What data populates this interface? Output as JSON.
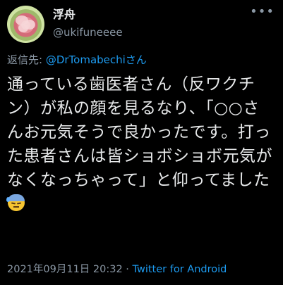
{
  "user": {
    "display_name": "浮舟",
    "handle": "@ukifuneeee"
  },
  "reply": {
    "prefix": "返信先: ",
    "mention": "@DrTomabechiさん"
  },
  "tweet": {
    "text": "通っている歯医者さん（反ワクチン）が私の顔を見るなり、「○○さんお元気そうで良かったです。打った患者さんは皆ショボショボ元気がなくなっちゃって」と仰ってました",
    "emoji": "downcast-face-with-sweat"
  },
  "meta": {
    "timestamp": "2021年09月11日 20:32",
    "separator": " · ",
    "source": "Twitter for Android"
  },
  "icons": {
    "more": "more-dots-icon"
  },
  "colors": {
    "background": "#000000",
    "text": "#e7e9ea",
    "secondary": "#8b98a5",
    "link": "#1d9bf0"
  }
}
